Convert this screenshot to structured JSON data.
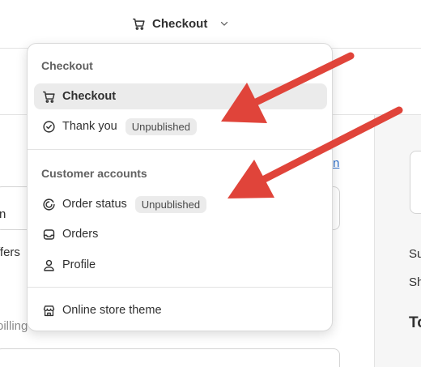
{
  "topbar": {
    "page_switcher_label": "Checkout"
  },
  "background": {
    "partial_text_1": "n",
    "partial_text_2": "ffers",
    "partial_text_3": "oilling",
    "partial_link": "n",
    "right_text_1": "Su",
    "right_text_2": "Sh",
    "right_text_3": "To"
  },
  "dropdown": {
    "sections": [
      {
        "title": "Checkout",
        "items": [
          {
            "label": "Checkout",
            "icon": "cart-icon",
            "selected": true
          },
          {
            "label": "Thank you",
            "icon": "check-circle-icon",
            "badge": "Unpublished"
          }
        ]
      },
      {
        "title": "Customer accounts",
        "items": [
          {
            "label": "Order status",
            "icon": "order-status-icon",
            "badge": "Unpublished"
          },
          {
            "label": "Orders",
            "icon": "inbox-icon"
          },
          {
            "label": "Profile",
            "icon": "person-icon"
          }
        ]
      },
      {
        "items": [
          {
            "label": "Online store theme",
            "icon": "store-icon"
          }
        ]
      }
    ]
  },
  "colors": {
    "arrow": "#e0443a",
    "selected_bg": "#ebebeb",
    "badge_bg": "#ebebeb",
    "link": "#2c6ecb"
  }
}
